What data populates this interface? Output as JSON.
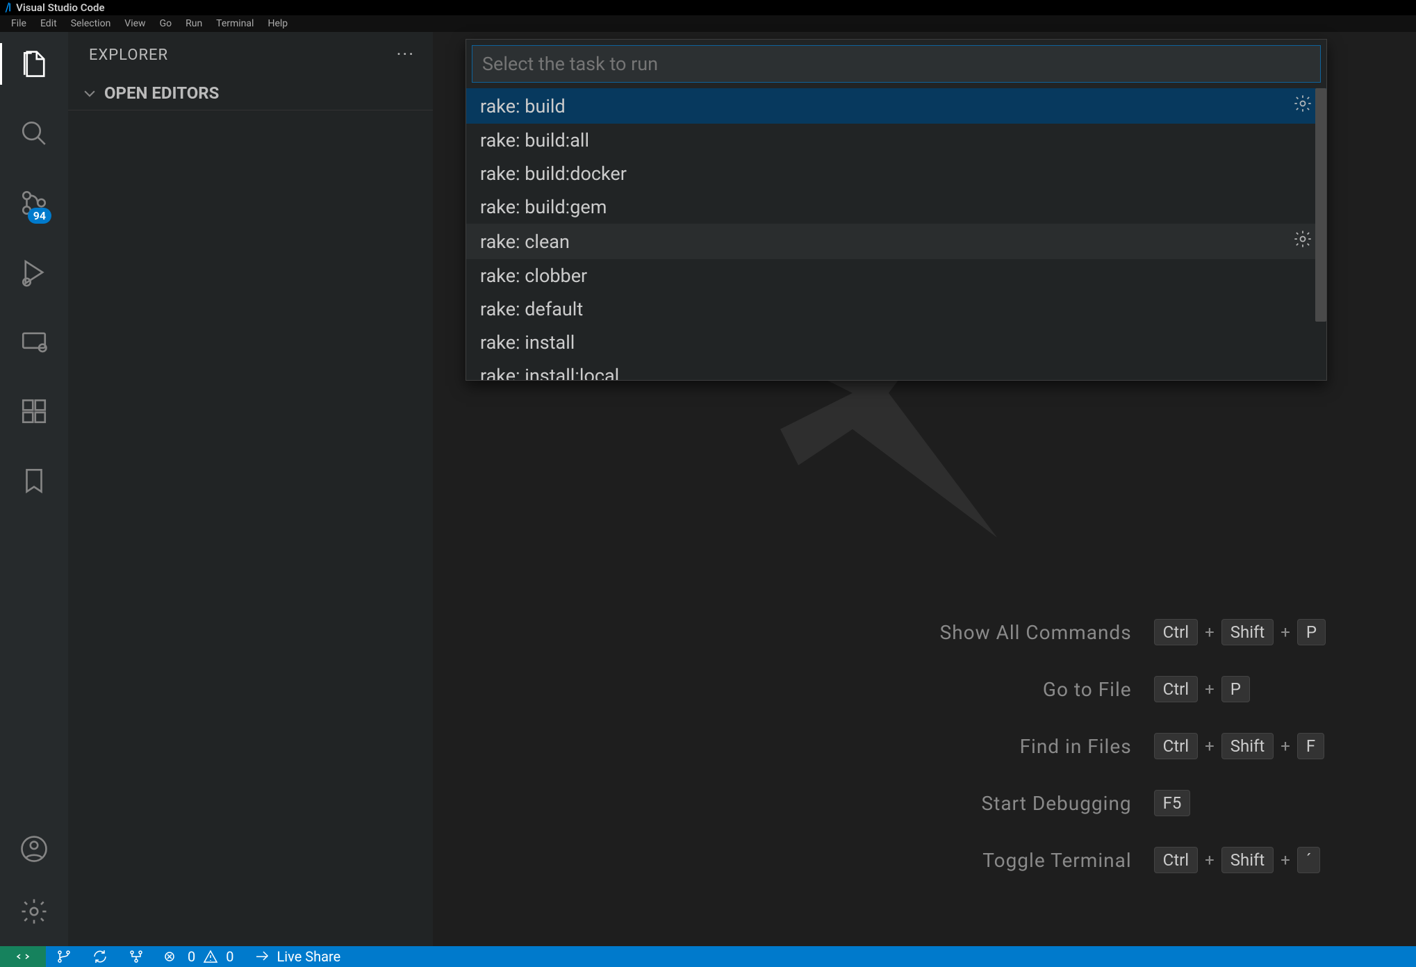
{
  "titlebar": {
    "app_name": "Visual Studio Code"
  },
  "menubar": [
    "File",
    "Edit",
    "Selection",
    "View",
    "Go",
    "Run",
    "Terminal",
    "Help"
  ],
  "activitybar": {
    "scm_badge": "94"
  },
  "sidebar": {
    "title": "EXPLORER",
    "section": "OPEN EDITORS"
  },
  "quickpick": {
    "placeholder": "Select the task to run",
    "items": [
      {
        "label": "rake: build",
        "selected": true,
        "gear": true
      },
      {
        "label": "rake: build:all"
      },
      {
        "label": "rake: build:docker"
      },
      {
        "label": "rake: build:gem"
      },
      {
        "label": "rake: clean",
        "hover": true,
        "gear": true
      },
      {
        "label": "rake: clobber"
      },
      {
        "label": "rake: default"
      },
      {
        "label": "rake: install"
      },
      {
        "label": "rake: install:local"
      }
    ]
  },
  "shortcuts": [
    {
      "label": "Show All Commands",
      "keys": [
        "Ctrl",
        "Shift",
        "P"
      ]
    },
    {
      "label": "Go to File",
      "keys": [
        "Ctrl",
        "P"
      ]
    },
    {
      "label": "Find in Files",
      "keys": [
        "Ctrl",
        "Shift",
        "F"
      ]
    },
    {
      "label": "Start Debugging",
      "keys": [
        "F5"
      ]
    },
    {
      "label": "Toggle Terminal",
      "keys": [
        "Ctrl",
        "Shift",
        "´"
      ]
    }
  ],
  "statusbar": {
    "errors": "0",
    "warnings": "0",
    "liveshare": "Live Share"
  }
}
